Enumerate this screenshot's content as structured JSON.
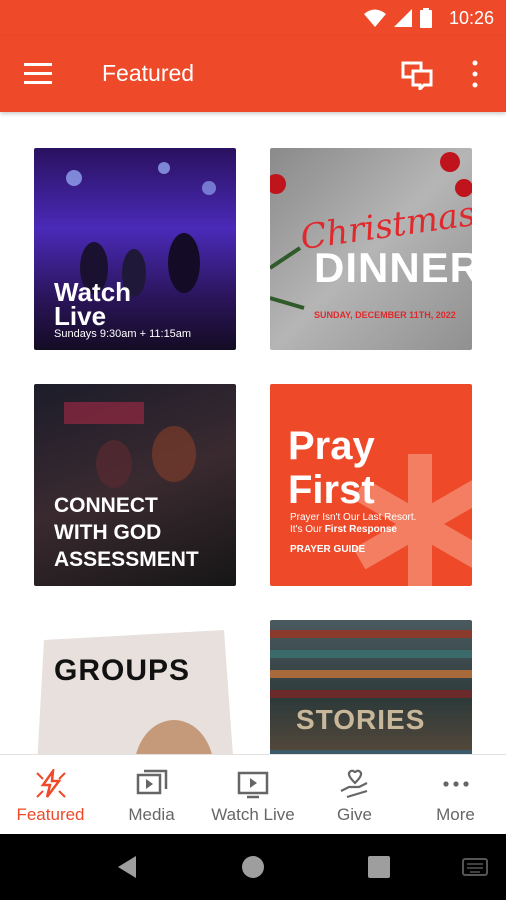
{
  "status": {
    "time": "10:26"
  },
  "appbar": {
    "title": "Featured",
    "icons": [
      "menu-icon",
      "chat-icon",
      "more-vert-icon"
    ]
  },
  "cards": [
    {
      "line1": "Watch",
      "line2": "Live",
      "sub": "Sundays 9:30am + 11:15am"
    },
    {
      "script": "Christmas",
      "title": "DINNER",
      "date": "SUNDAY, DECEMBER 11TH, 2022"
    },
    {
      "line1": "CONNECT",
      "line2": "WITH GOD",
      "line3": "ASSESSMENT"
    },
    {
      "line1": "Pray",
      "line2": "First",
      "sub1": "Prayer Isn't Our Last Resort.",
      "sub2a": "It's Our ",
      "sub2b": "First Response",
      "guide": "PRAYER GUIDE"
    },
    {
      "title": "GROUPS"
    },
    {
      "title": "STORIES"
    }
  ],
  "tabs": [
    {
      "label": "Featured",
      "icon": "featured-icon",
      "active": true
    },
    {
      "label": "Media",
      "icon": "media-icon"
    },
    {
      "label": "Watch Live",
      "icon": "watch-live-icon"
    },
    {
      "label": "Give",
      "icon": "give-icon"
    },
    {
      "label": "More",
      "icon": "more-horiz-icon"
    }
  ],
  "colors": {
    "accent": "#ee4a2a"
  }
}
